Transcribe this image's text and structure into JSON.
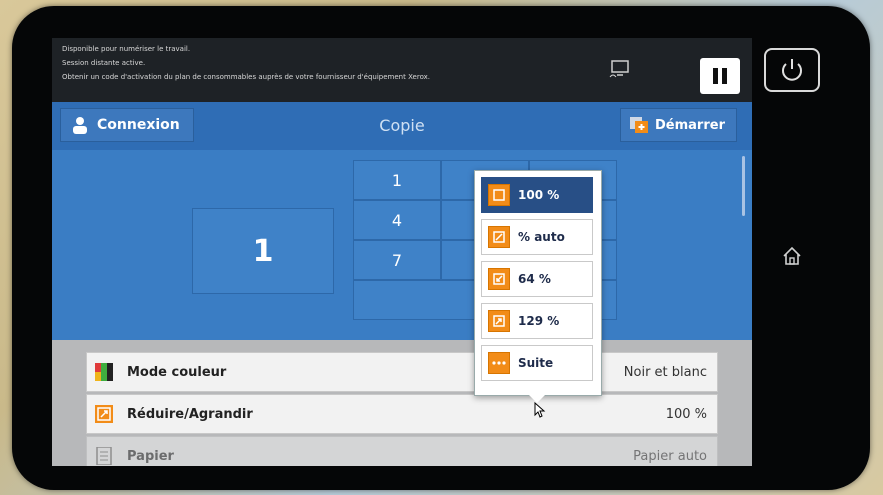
{
  "status": {
    "line1": "Disponible pour numériser le travail.",
    "line2": "Session distante active.",
    "line3": "Obtenir un code d'activation du plan de consommables auprès de votre fournisseur d'équipement Xerox."
  },
  "header": {
    "connect_label": "Connexion",
    "title": "Copie",
    "start_label": "Démarrer"
  },
  "quantity": "1",
  "keypad": [
    "1",
    "4",
    "7"
  ],
  "popup": {
    "options": [
      {
        "label": "100 %",
        "selected": true
      },
      {
        "label": "% auto",
        "selected": false
      },
      {
        "label": "64 %",
        "selected": false
      },
      {
        "label": "129 %",
        "selected": false
      },
      {
        "label": "Suite",
        "selected": false
      }
    ]
  },
  "settings": [
    {
      "label": "Mode couleur",
      "value": "Noir et blanc",
      "icon": "color-mode-icon"
    },
    {
      "label": "Réduire/Agrandir",
      "value": "100 %",
      "icon": "reduce-enlarge-icon"
    },
    {
      "label": "Papier",
      "value": "Papier auto",
      "icon": "paper-icon"
    }
  ],
  "colors": {
    "accent": "#3a7dc4",
    "orange": "#f28c18",
    "selected": "#284f86"
  }
}
